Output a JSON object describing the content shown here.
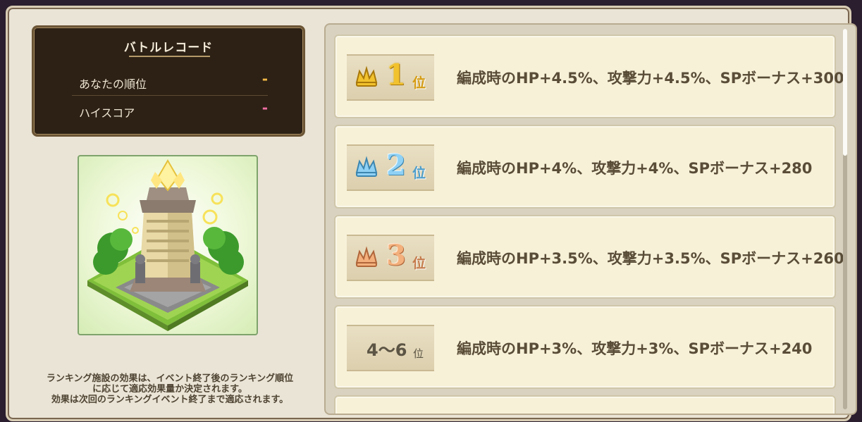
{
  "battle_record": {
    "title": "バトルレコード",
    "rank_label": "あなたの順位",
    "rank_value": "-",
    "highscore_label": "ハイスコア",
    "highscore_value": "-"
  },
  "note": {
    "line1": "ランキング施設の効果は、イベント終了後のランキング順位",
    "line2": "に応じて適応効果量か決定されます。",
    "line3": "効果は次回のランキングイベント終了まで適応されます。"
  },
  "rewards": [
    {
      "rank": "1",
      "suffix": "位",
      "text": "編成時のHP+4.5%、攻撃力+4.5%、SPボーナス+300",
      "crown_color": "#f2c22e"
    },
    {
      "rank": "2",
      "suffix": "位",
      "text": "編成時のHP+4%、攻撃力+4%、SPボーナス+280",
      "crown_color": "#8fd1f5"
    },
    {
      "rank": "3",
      "suffix": "位",
      "text": "編成時のHP+3.5%、攻撃力+3.5%、SPボーナス+260",
      "crown_color": "#f3b07c"
    },
    {
      "rank": "4〜6",
      "suffix": "位",
      "text": "編成時のHP+3%、攻撃力+3%、SPボーナス+240",
      "crown_color": ""
    }
  ]
}
